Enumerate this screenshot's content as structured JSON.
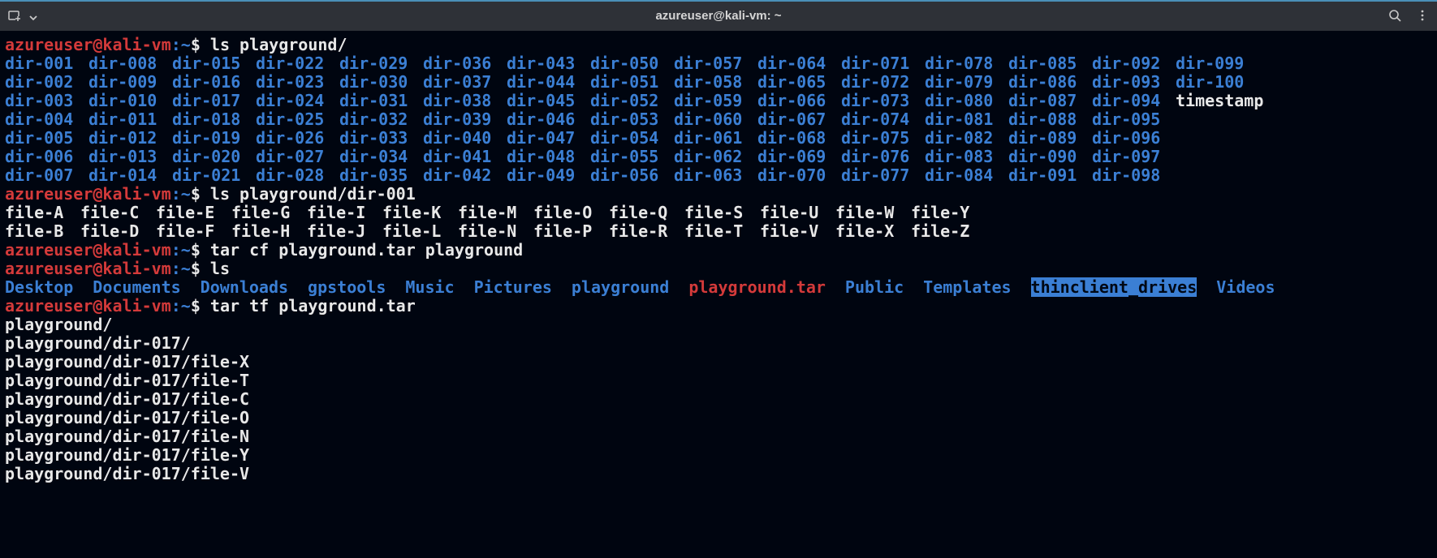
{
  "titlebar": {
    "title": "azureuser@kali-vm: ~"
  },
  "prompt": {
    "user": "azureuser",
    "at": "@",
    "host": "kali-vm",
    "colon": ":",
    "path": "~",
    "dollar": "$"
  },
  "commands": {
    "cmd1": "ls playground/",
    "cmd2": "ls playground/dir-001",
    "cmd3": "tar cf playground.tar playground",
    "cmd4": "ls",
    "cmd5": "tar tf playground.tar"
  },
  "playground_dirs": {
    "rows": [
      [
        "dir-001",
        "dir-008",
        "dir-015",
        "dir-022",
        "dir-029",
        "dir-036",
        "dir-043",
        "dir-050",
        "dir-057",
        "dir-064",
        "dir-071",
        "dir-078",
        "dir-085",
        "dir-092",
        "dir-099"
      ],
      [
        "dir-002",
        "dir-009",
        "dir-016",
        "dir-023",
        "dir-030",
        "dir-037",
        "dir-044",
        "dir-051",
        "dir-058",
        "dir-065",
        "dir-072",
        "dir-079",
        "dir-086",
        "dir-093",
        "dir-100"
      ],
      [
        "dir-003",
        "dir-010",
        "dir-017",
        "dir-024",
        "dir-031",
        "dir-038",
        "dir-045",
        "dir-052",
        "dir-059",
        "dir-066",
        "dir-073",
        "dir-080",
        "dir-087",
        "dir-094",
        "timestamp"
      ],
      [
        "dir-004",
        "dir-011",
        "dir-018",
        "dir-025",
        "dir-032",
        "dir-039",
        "dir-046",
        "dir-053",
        "dir-060",
        "dir-067",
        "dir-074",
        "dir-081",
        "dir-088",
        "dir-095",
        ""
      ],
      [
        "dir-005",
        "dir-012",
        "dir-019",
        "dir-026",
        "dir-033",
        "dir-040",
        "dir-047",
        "dir-054",
        "dir-061",
        "dir-068",
        "dir-075",
        "dir-082",
        "dir-089",
        "dir-096",
        ""
      ],
      [
        "dir-006",
        "dir-013",
        "dir-020",
        "dir-027",
        "dir-034",
        "dir-041",
        "dir-048",
        "dir-055",
        "dir-062",
        "dir-069",
        "dir-076",
        "dir-083",
        "dir-090",
        "dir-097",
        ""
      ],
      [
        "dir-007",
        "dir-014",
        "dir-021",
        "dir-028",
        "dir-035",
        "dir-042",
        "dir-049",
        "dir-056",
        "dir-063",
        "dir-070",
        "dir-077",
        "dir-084",
        "dir-091",
        "dir-098",
        ""
      ]
    ]
  },
  "dir001_files": {
    "rows": [
      [
        "file-A",
        "file-C",
        "file-E",
        "file-G",
        "file-I",
        "file-K",
        "file-M",
        "file-O",
        "file-Q",
        "file-S",
        "file-U",
        "file-W",
        "file-Y"
      ],
      [
        "file-B",
        "file-D",
        "file-F",
        "file-H",
        "file-J",
        "file-L",
        "file-N",
        "file-P",
        "file-R",
        "file-T",
        "file-V",
        "file-X",
        "file-Z"
      ]
    ]
  },
  "home_ls": {
    "items": [
      {
        "name": "Desktop",
        "cls": "dir-blue"
      },
      {
        "name": "Documents",
        "cls": "dir-blue"
      },
      {
        "name": "Downloads",
        "cls": "dir-blue"
      },
      {
        "name": "gpstools",
        "cls": "dir-blue"
      },
      {
        "name": "Music",
        "cls": "dir-blue"
      },
      {
        "name": "Pictures",
        "cls": "dir-blue"
      },
      {
        "name": "playground",
        "cls": "dir-blue"
      },
      {
        "name": "playground.tar",
        "cls": "tar-red"
      },
      {
        "name": "Public",
        "cls": "dir-blue"
      },
      {
        "name": "Templates",
        "cls": "dir-blue"
      },
      {
        "name": "thinclient_drives",
        "cls": "highlight-bg"
      },
      {
        "name": "Videos",
        "cls": "dir-blue"
      }
    ]
  },
  "tar_tf": {
    "lines": [
      "playground/",
      "playground/dir-017/",
      "playground/dir-017/file-X",
      "playground/dir-017/file-T",
      "playground/dir-017/file-C",
      "playground/dir-017/file-O",
      "playground/dir-017/file-N",
      "playground/dir-017/file-Y",
      "playground/dir-017/file-V"
    ]
  }
}
